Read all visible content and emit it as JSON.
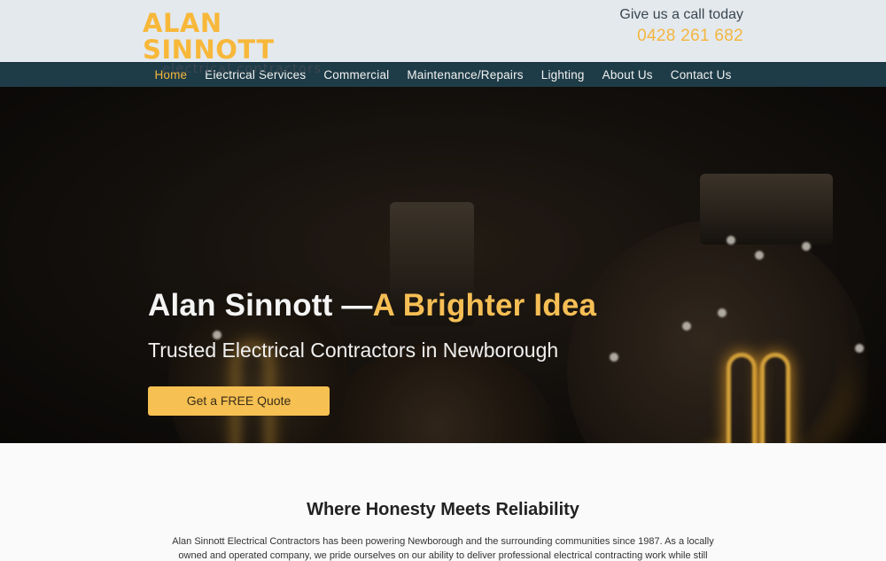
{
  "brand": {
    "name": "ALAN SINNOTT",
    "tagline": "electrical contractors",
    "accent_color": "#f6b73c",
    "nav_color": "#1e3c47"
  },
  "contact": {
    "label": "Give us a call today",
    "phone": "0428 261 682"
  },
  "nav": {
    "items": [
      {
        "label": "Home",
        "active": true
      },
      {
        "label": "Electrical Services"
      },
      {
        "label": "Commercial"
      },
      {
        "label": "Maintenance/Repairs"
      },
      {
        "label": "Lighting"
      },
      {
        "label": "About Us"
      },
      {
        "label": "Contact Us"
      }
    ]
  },
  "hero": {
    "title_main": "Alan Sinnott —",
    "title_accent": "A Brighter Idea",
    "subtitle": "Trusted Electrical Contractors in Newborough",
    "cta_label": "Get a FREE Quote",
    "background_icon": "filament-bulbs-photo"
  },
  "intro": {
    "title": "Where Honesty Meets Reliability",
    "text": "Alan Sinnott Electrical Contractors has been powering Newborough and the surrounding communities since 1987. As a locally owned and operated company, we pride ourselves on our ability to deliver professional electrical contracting work while still"
  }
}
